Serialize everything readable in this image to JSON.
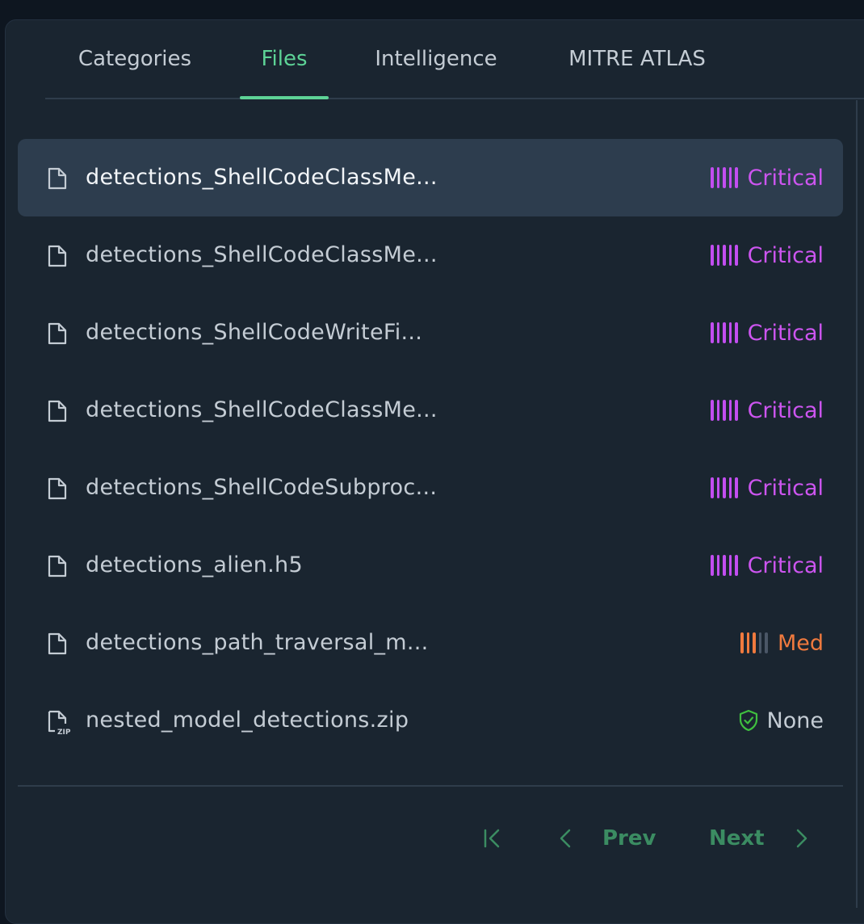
{
  "tabs": [
    {
      "label": "Categories"
    },
    {
      "label": "Files"
    },
    {
      "label": "Intelligence"
    },
    {
      "label": "MITRE ATLAS"
    }
  ],
  "files": [
    {
      "name": "detections_ShellCodeClassMe...",
      "severity": "Critical",
      "level": 5
    },
    {
      "name": "detections_ShellCodeClassMe...",
      "severity": "Critical",
      "level": 5
    },
    {
      "name": "detections_ShellCodeWriteFi...",
      "severity": "Critical",
      "level": 5
    },
    {
      "name": "detections_ShellCodeClassMe...",
      "severity": "Critical",
      "level": 5
    },
    {
      "name": "detections_ShellCodeSubproc...",
      "severity": "Critical",
      "level": 5
    },
    {
      "name": "detections_alien.h5",
      "severity": "Critical",
      "level": 5
    },
    {
      "name": "detections_path_traversal_m...",
      "severity": "Med",
      "level": 3
    },
    {
      "name": "nested_model_detections.zip",
      "severity": "None",
      "level": 0
    }
  ],
  "file_icon_zip_label": "ZIP",
  "pagination": {
    "prev_label": "Prev",
    "next_label": "Next"
  },
  "colors": {
    "accent": "#5dd396",
    "critical": "#cd55f0",
    "med": "#f07a3e",
    "none_shield": "#3fbf3f",
    "pager": "#3b8c62"
  }
}
